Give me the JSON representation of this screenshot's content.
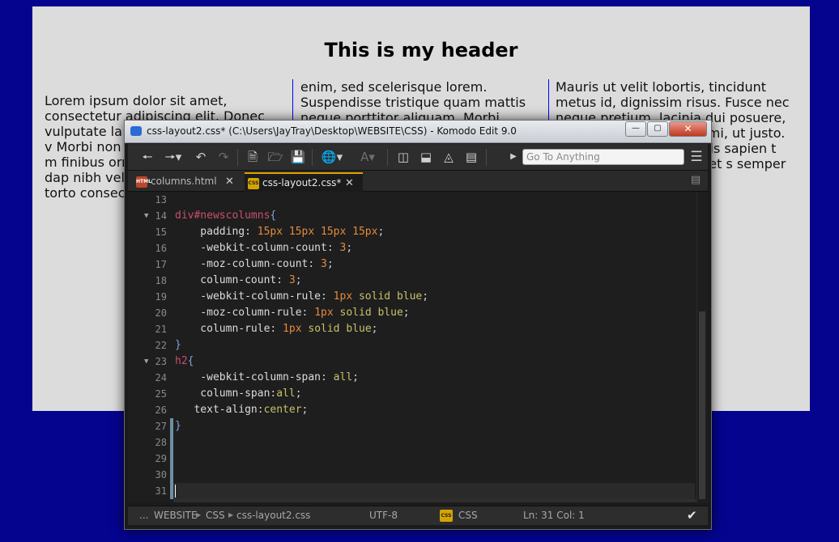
{
  "page": {
    "header": "This is my header",
    "columns": [
      "Lorem ipsum dolor sit amet, consectetur adipiscing elit. Donec vulputate la aliquet dolo lorem. Sed v Morbi non li consequat n Phasellus m finibus orna eleifend arcu pulvinar dap nibh vel sod lacus ultricie rutrum torto consectetur vestibulum.",
      "enim, sed scelerisque lorem. Suspendisse tristique quam mattis neque porttitor aliquam. Morbi",
      "Mauris ut velit lobortis, tincidunt metus id, dignissim risus. Fusce nec neque pretium, lacinia dui posuere, consequat, endrerit, m mi, ut justo. eu turpis attis lacinia lisis sapien t nulla vel ac felis. ibh eget s semper p."
    ]
  },
  "window": {
    "title": "css-layout2.css* (C:\\Users\\JayTray\\Desktop\\WEBSITE\\CSS) - Komodo Edit 9.0",
    "buttons": {
      "minimize": "—",
      "maximize": "▢",
      "close": "✕"
    }
  },
  "toolbar": {
    "goto_placeholder": "Go To Anything"
  },
  "tabs": [
    {
      "label": "columns.html",
      "icon": "HTML",
      "active": false
    },
    {
      "label": "css-layout2.css*",
      "icon": "CSS",
      "active": true
    }
  ],
  "editor": {
    "lines": [
      {
        "n": "13",
        "fold": "",
        "tokens": []
      },
      {
        "n": "14",
        "fold": "▼",
        "tokens": [
          [
            "sel",
            "div"
          ],
          [
            "sel",
            "#newscolumns"
          ],
          [
            "brace",
            "{"
          ]
        ]
      },
      {
        "n": "15",
        "fold": "",
        "tokens": [
          [
            "prop",
            "    padding"
          ],
          [
            "punc",
            ": "
          ],
          [
            "num",
            "15px 15px 15px 15px"
          ],
          [
            "punc",
            ";"
          ]
        ]
      },
      {
        "n": "16",
        "fold": "",
        "tokens": [
          [
            "prop",
            "    -webkit-column-count"
          ],
          [
            "punc",
            ": "
          ],
          [
            "num",
            "3"
          ],
          [
            "punc",
            ";"
          ]
        ]
      },
      {
        "n": "17",
        "fold": "",
        "tokens": [
          [
            "prop",
            "    -moz-column-count"
          ],
          [
            "punc",
            ": "
          ],
          [
            "num",
            "3"
          ],
          [
            "punc",
            ";"
          ]
        ]
      },
      {
        "n": "18",
        "fold": "",
        "tokens": [
          [
            "prop",
            "    column-count"
          ],
          [
            "punc",
            ": "
          ],
          [
            "num",
            "3"
          ],
          [
            "punc",
            ";"
          ]
        ]
      },
      {
        "n": "19",
        "fold": "",
        "tokens": [
          [
            "prop",
            "    -webkit-column-rule"
          ],
          [
            "punc",
            ": "
          ],
          [
            "num",
            "1px "
          ],
          [
            "val",
            "solid blue"
          ],
          [
            "punc",
            ";"
          ]
        ]
      },
      {
        "n": "20",
        "fold": "",
        "tokens": [
          [
            "prop",
            "    -moz-column-rule"
          ],
          [
            "punc",
            ": "
          ],
          [
            "num",
            "1px "
          ],
          [
            "val",
            "solid blue"
          ],
          [
            "punc",
            ";"
          ]
        ]
      },
      {
        "n": "21",
        "fold": "",
        "tokens": [
          [
            "prop",
            "    column-rule"
          ],
          [
            "punc",
            ": "
          ],
          [
            "num",
            "1px "
          ],
          [
            "val",
            "solid blue"
          ],
          [
            "punc",
            ";"
          ]
        ]
      },
      {
        "n": "22",
        "fold": "",
        "tokens": [
          [
            "brace",
            "}"
          ]
        ]
      },
      {
        "n": "23",
        "fold": "▼",
        "tokens": [
          [
            "sel",
            "h2"
          ],
          [
            "brace",
            "{"
          ]
        ]
      },
      {
        "n": "24",
        "fold": "",
        "tokens": [
          [
            "prop",
            "    -webkit-column-span"
          ],
          [
            "punc",
            ": "
          ],
          [
            "val",
            "all"
          ],
          [
            "punc",
            ";"
          ]
        ]
      },
      {
        "n": "25",
        "fold": "",
        "tokens": [
          [
            "prop",
            "    column-span"
          ],
          [
            "punc",
            ":"
          ],
          [
            "val",
            "all"
          ],
          [
            "punc",
            ";"
          ]
        ]
      },
      {
        "n": "26",
        "fold": "",
        "tokens": [
          [
            "prop",
            "   text-align"
          ],
          [
            "punc",
            ":"
          ],
          [
            "val",
            "center"
          ],
          [
            "punc",
            ";"
          ]
        ]
      },
      {
        "n": "27",
        "fold": "",
        "tokens": [
          [
            "brace",
            "}"
          ]
        ]
      },
      {
        "n": "28",
        "fold": "",
        "tokens": []
      },
      {
        "n": "29",
        "fold": "",
        "tokens": []
      },
      {
        "n": "30",
        "fold": "",
        "tokens": []
      },
      {
        "n": "31",
        "fold": "",
        "tokens": []
      }
    ]
  },
  "status": {
    "breadcrumb_ellipsis": "...",
    "breadcrumb": [
      "WEBSITE",
      "CSS",
      "css-layout2.css"
    ],
    "encoding": "UTF-8",
    "language_icon": "CSS",
    "language": "CSS",
    "position": "Ln: 31 Col: 1"
  },
  "colors": {
    "desktop": "#04048f",
    "editor_bg": "#1e1e1e",
    "selector": "#c94f6d",
    "number": "#e48a3c",
    "value": "#c7c26a",
    "active_tab_accent": "#e0a400"
  }
}
